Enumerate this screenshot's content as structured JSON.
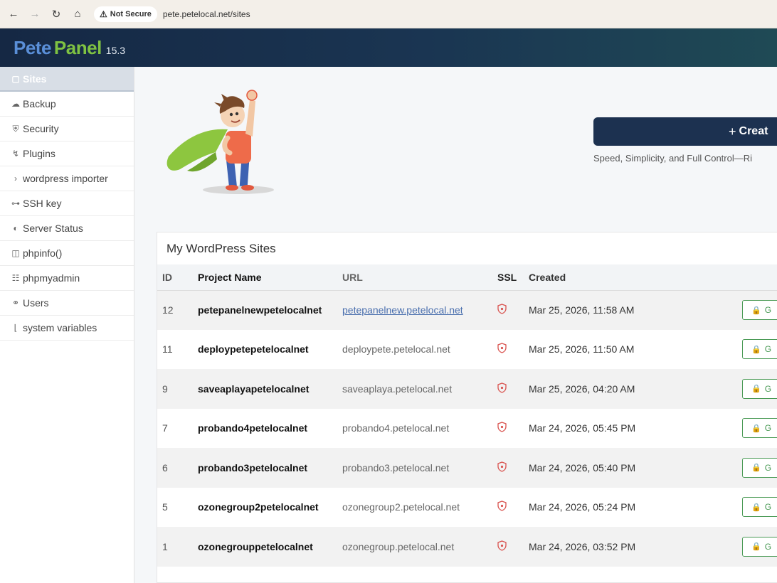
{
  "browser": {
    "security_label": "Not Secure",
    "url": "pete.petelocal.net/sites"
  },
  "app": {
    "logo_pete": "Pete",
    "logo_panel": "Panel",
    "version": "15.3"
  },
  "sidebar": {
    "items": [
      {
        "label": "Sites",
        "icon": "window-icon"
      },
      {
        "label": "Backup",
        "icon": "cloud-icon"
      },
      {
        "label": "Security",
        "icon": "shield-icon"
      },
      {
        "label": "Plugins",
        "icon": "plug-icon"
      },
      {
        "label": "wordpress importer",
        "icon": "chevron-right-icon"
      },
      {
        "label": "SSH key",
        "icon": "key-icon"
      },
      {
        "label": "Server Status",
        "icon": "gauge-icon"
      },
      {
        "label": "phpinfo()",
        "icon": "file-icon"
      },
      {
        "label": "phpmyadmin",
        "icon": "database-icon"
      },
      {
        "label": "Users",
        "icon": "users-icon"
      },
      {
        "label": "system variables",
        "icon": "sliders-icon"
      }
    ]
  },
  "main": {
    "create_button": "Creat",
    "tagline": "Speed, Simplicity, and Full Control—Ri",
    "sites_title": "My WordPress Sites",
    "columns": [
      "ID",
      "Project Name",
      "URL",
      "SSL",
      "Created"
    ],
    "action_label": "G",
    "rows": [
      {
        "id": "12",
        "name": "petepanelnewpetelocalnet",
        "url": "petepanelnew.petelocal.net",
        "created": "Mar 25, 2026, 11:58 AM"
      },
      {
        "id": "11",
        "name": "deploypetepetelocalnet",
        "url": "deploypete.petelocal.net",
        "created": "Mar 25, 2026, 11:50 AM"
      },
      {
        "id": "9",
        "name": "saveaplayapetelocalnet",
        "url": "saveaplaya.petelocal.net",
        "created": "Mar 25, 2026, 04:20 AM"
      },
      {
        "id": "7",
        "name": "probando4petelocalnet",
        "url": "probando4.petelocal.net",
        "created": "Mar 24, 2026, 05:45 PM"
      },
      {
        "id": "6",
        "name": "probando3petelocalnet",
        "url": "probando3.petelocal.net",
        "created": "Mar 24, 2026, 05:40 PM"
      },
      {
        "id": "5",
        "name": "ozonegroup2petelocalnet",
        "url": "ozonegroup2.petelocal.net",
        "created": "Mar 24, 2026, 05:24 PM"
      },
      {
        "id": "1",
        "name": "ozonegrouppetelocalnet",
        "url": "ozonegroup.petelocal.net",
        "created": "Mar 24, 2026, 03:52 PM"
      }
    ]
  },
  "colors": {
    "header_bg": "#152844",
    "logo_pete": "#5a8fd8",
    "logo_panel": "#7fc242",
    "create_bg": "#1c3150",
    "ssl_shield": "#d9534f",
    "go_green": "#4a9a55"
  }
}
